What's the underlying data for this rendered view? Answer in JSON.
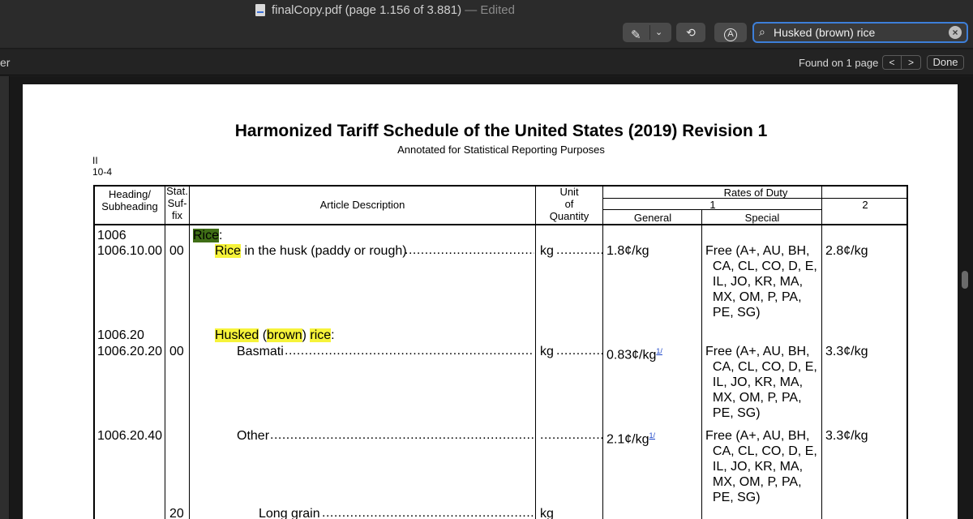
{
  "window": {
    "doc_name": "finalCopy.pdf",
    "page_info": "(page 1.156 of 3.881)",
    "edited": "— Edited"
  },
  "toolbar": {
    "markup_icon": "pen-icon",
    "rotate_icon": "rotate-icon",
    "annotate_icon": "markup-circle-icon"
  },
  "search": {
    "value": "Husked (brown) rice"
  },
  "findbar": {
    "left_fragment": "er",
    "found_text": "Found on 1 page",
    "prev": "<",
    "next": ">",
    "done": "Done"
  },
  "page": {
    "title": "Harmonized Tariff Schedule of the United States (2019) Revision 1",
    "subtitle": "Annotated for Statistical Reporting Purposes",
    "chapter_line1": "II",
    "chapter_line2": "10-4",
    "headers": {
      "heading": "Heading/\nSubheading",
      "stat": "Stat.\nSuf-\nfix",
      "desc": "Article Description",
      "unit": "Unit\nof\nQuantity",
      "rates": "Rates of Duty",
      "col1": "1",
      "col2": "2",
      "general": "General",
      "special": "Special"
    },
    "rows": [
      {
        "heading": "1006",
        "desc_hl": "Rice",
        "desc_rest": ":"
      },
      {
        "heading": "1006.10.00",
        "stat": "00",
        "desc_hl": "Rice",
        "desc_rest": " in the husk (paddy or rough)",
        "unit": "kg",
        "general": "1.8¢/kg",
        "special": "Free (A+, AU, BH,\n  CA, CL, CO, D, E,\n  IL, JO, KR, MA,\n  MX, OM, P, PA,\n  PE, SG)",
        "col2": "2.8¢/kg"
      },
      {
        "heading": "1006.20",
        "desc_hl1": "Husked",
        "desc_p1": " (",
        "desc_hl2": "brown",
        "desc_p2": ") ",
        "desc_hl3": "rice",
        "desc_p3": ":"
      },
      {
        "heading": "1006.20.20",
        "stat": "00",
        "desc": "Basmati",
        "unit": "kg",
        "general": "0.83¢/kg",
        "footnote": "1/",
        "special": "Free (A+, AU, BH,\n  CA, CL, CO, D, E,\n  IL, JO, KR, MA,\n  MX, OM, P, PA,\n  PE, SG)",
        "col2": "3.3¢/kg"
      },
      {
        "heading": "1006.20.40",
        "desc": "Other",
        "general": "2.1¢/kg",
        "footnote": "1/",
        "special": "Free (A+, AU, BH,\n  CA, CL, CO, D, E,\n  IL, JO, KR, MA,\n  MX, OM, P, PA,\n  PE, SG)",
        "col2": "3.3¢/kg"
      },
      {
        "stat": "20",
        "desc": "Long grain",
        "unit": "kg"
      }
    ]
  }
}
